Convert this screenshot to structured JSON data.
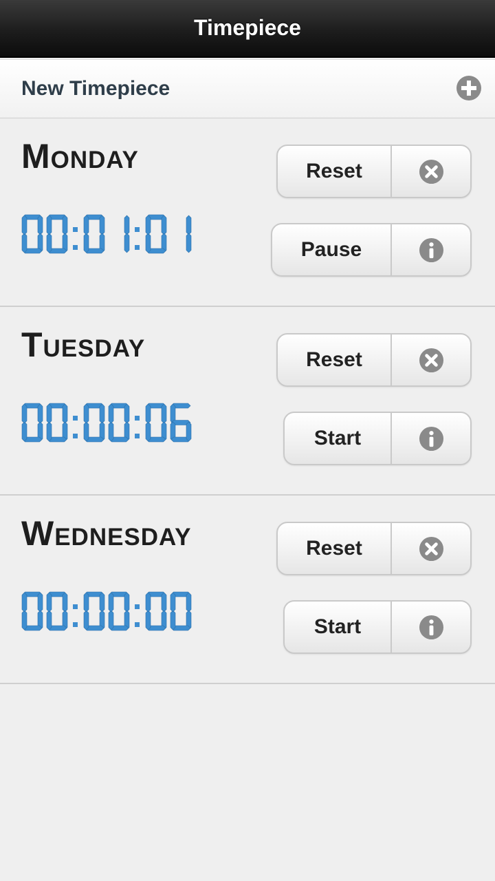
{
  "app": {
    "title": "Timepiece"
  },
  "new_timepiece": {
    "label": "New Timepiece",
    "icon": "plus-circle-icon"
  },
  "colors": {
    "digit": "#3e8ed0",
    "icon": "#8a8a8a"
  },
  "timepieces": [
    {
      "name": "Monday",
      "time": "00:01:01",
      "reset_label": "Reset",
      "action_label": "Pause",
      "delete_icon": "close-circle-icon",
      "info_icon": "info-circle-icon"
    },
    {
      "name": "Tuesday",
      "time": "00:00:06",
      "reset_label": "Reset",
      "action_label": "Start",
      "delete_icon": "close-circle-icon",
      "info_icon": "info-circle-icon"
    },
    {
      "name": "Wednesday",
      "time": "00:00:00",
      "reset_label": "Reset",
      "action_label": "Start",
      "delete_icon": "close-circle-icon",
      "info_icon": "info-circle-icon"
    }
  ]
}
